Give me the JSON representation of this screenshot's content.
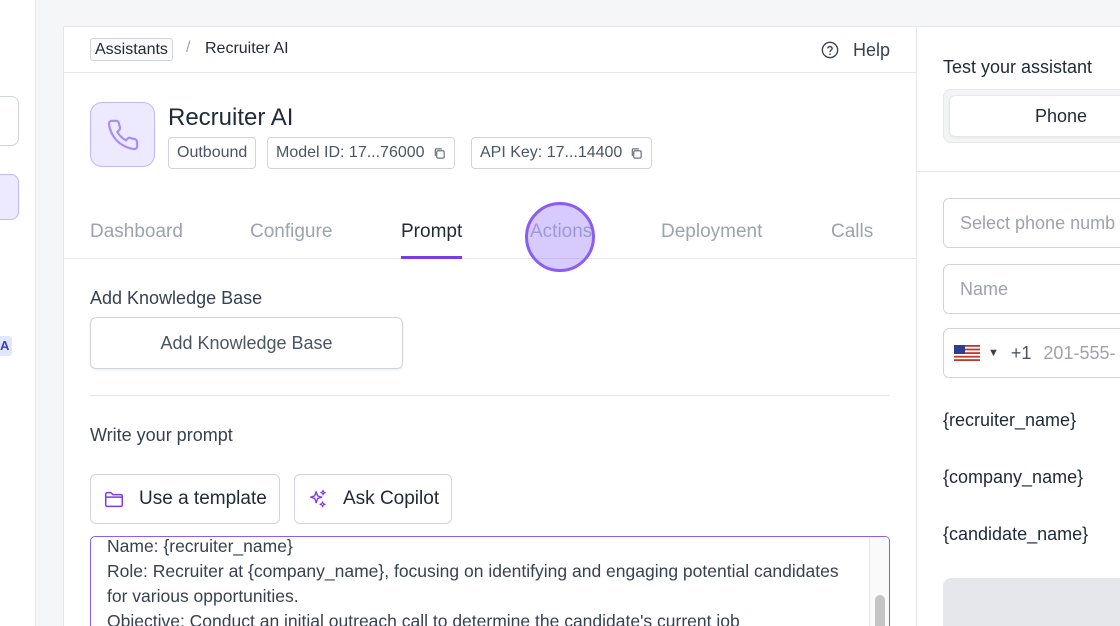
{
  "breadcrumb": {
    "root": "Assistants",
    "separator": "/",
    "current": "Recruiter AI"
  },
  "help_label": "Help",
  "assistant": {
    "name": "Recruiter AI",
    "direction": "Outbound",
    "model_id": "Model ID: 17...76000",
    "api_key": "API Key: 17...14400"
  },
  "tabs": [
    {
      "label": "Dashboard",
      "active": false
    },
    {
      "label": "Configure",
      "active": false
    },
    {
      "label": "Prompt",
      "active": true
    },
    {
      "label": "Actions",
      "active": false
    },
    {
      "label": "Deployment",
      "active": false
    },
    {
      "label": "Calls",
      "active": false
    }
  ],
  "knowledge_base": {
    "label": "Add Knowledge Base",
    "button": "Add Knowledge Base"
  },
  "prompt": {
    "label": "Write your prompt",
    "template_button": "Use a template",
    "copilot_button": "Ask Copilot",
    "text": "Name: {recruiter_name}\nRole: Recruiter at {company_name}, focusing on identifying and engaging potential candidates for various opportunities.\nObjective: Conduct an initial outreach call to determine the candidate's current job"
  },
  "test_panel": {
    "title": "Test your assistant",
    "mode_phone": "Phone",
    "phone_select_placeholder": "Select phone numb",
    "name_placeholder": "Name",
    "dial_code": "+1",
    "phone_placeholder": "201-555-",
    "variables": [
      "{recruiter_name}",
      "{company_name}",
      "{candidate_name}"
    ]
  },
  "rail": {
    "badge": "A"
  },
  "colors": {
    "accent": "#7c3aed",
    "accent_light": "#ede9fe"
  }
}
